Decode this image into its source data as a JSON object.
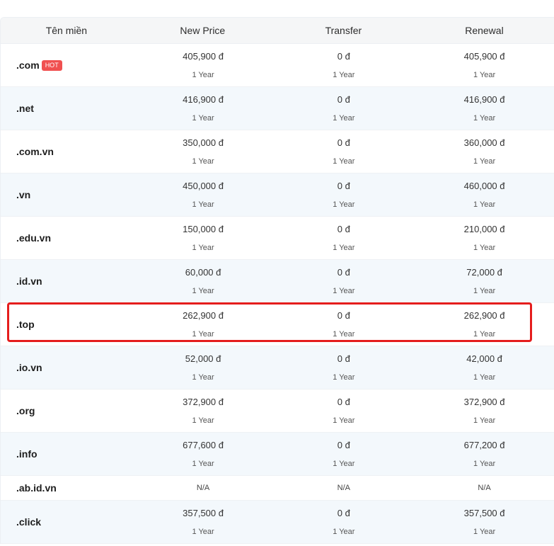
{
  "header": {
    "domain": "Tên miền",
    "new_price": "New Price",
    "transfer": "Transfer",
    "renewal": "Renewal"
  },
  "rows": [
    {
      "name": ".com",
      "badge": "HOT",
      "new_price": "405,900 đ",
      "new_period": "1 Year",
      "transfer": "0 đ",
      "transfer_period": "1 Year",
      "renewal": "405,900 đ",
      "renewal_period": "1 Year"
    },
    {
      "name": ".net",
      "new_price": "416,900 đ",
      "new_period": "1 Year",
      "transfer": "0 đ",
      "transfer_period": "1 Year",
      "renewal": "416,900 đ",
      "renewal_period": "1 Year"
    },
    {
      "name": ".com.vn",
      "new_price": "350,000 đ",
      "new_period": "1 Year",
      "transfer": "0 đ",
      "transfer_period": "1 Year",
      "renewal": "360,000 đ",
      "renewal_period": "1 Year"
    },
    {
      "name": ".vn",
      "new_price": "450,000 đ",
      "new_period": "1 Year",
      "transfer": "0 đ",
      "transfer_period": "1 Year",
      "renewal": "460,000 đ",
      "renewal_period": "1 Year"
    },
    {
      "name": ".edu.vn",
      "new_price": "150,000 đ",
      "new_period": "1 Year",
      "transfer": "0 đ",
      "transfer_period": "1 Year",
      "renewal": "210,000 đ",
      "renewal_period": "1 Year"
    },
    {
      "name": ".id.vn",
      "new_price": "60,000 đ",
      "new_period": "1 Year",
      "transfer": "0 đ",
      "transfer_period": "1 Year",
      "renewal": "72,000 đ",
      "renewal_period": "1 Year"
    },
    {
      "name": ".top",
      "new_price": "262,900 đ",
      "new_period": "1 Year",
      "transfer": "0 đ",
      "transfer_period": "1 Year",
      "renewal": "262,900 đ",
      "renewal_period": "1 Year"
    },
    {
      "name": ".io.vn",
      "new_price": "52,000 đ",
      "new_period": "1 Year",
      "transfer": "0 đ",
      "transfer_period": "1 Year",
      "renewal": "42,000 đ",
      "renewal_period": "1 Year"
    },
    {
      "name": ".org",
      "new_price": "372,900 đ",
      "new_period": "1 Year",
      "transfer": "0 đ",
      "transfer_period": "1 Year",
      "renewal": "372,900 đ",
      "renewal_period": "1 Year"
    },
    {
      "name": ".info",
      "new_price": "677,600 đ",
      "new_period": "1 Year",
      "transfer": "0 đ",
      "transfer_period": "1 Year",
      "renewal": "677,200 đ",
      "renewal_period": "1 Year"
    },
    {
      "name": ".ab.id.vn",
      "new_na": "N/A",
      "transfer_na": "N/A",
      "renewal_na": "N/A"
    },
    {
      "name": ".click",
      "new_price": "357,500 đ",
      "new_period": "1 Year",
      "transfer": "0 đ",
      "transfer_period": "1 Year",
      "renewal": "357,500 đ",
      "renewal_period": "1 Year"
    }
  ],
  "colors": {
    "highlight": "#e51d1d",
    "hot_badge": "#f05050",
    "alt_row": "#f3f8fc"
  }
}
